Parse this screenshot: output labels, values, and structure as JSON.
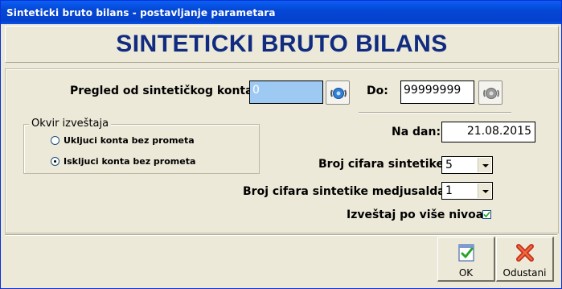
{
  "window": {
    "title": "Sinteticki bruto bilans - postavljanje parametara"
  },
  "heading": "SINTETICKI BRUTO BILANS",
  "range": {
    "from_label": "Pregled od sintetičkog konta:",
    "from_value": "0",
    "to_label": "Do:",
    "to_value": "99999999"
  },
  "frame": {
    "legend": "Okvir izveštaja",
    "options": [
      {
        "label": "Ukljuci konta bez prometa",
        "selected": false
      },
      {
        "label": "Iskljuci konta bez prometa",
        "selected": true
      }
    ]
  },
  "date": {
    "label": "Na dan:",
    "value": "21.08.2015"
  },
  "digits": {
    "label": "Broj cifara sintetike:",
    "value": "5"
  },
  "digits_mid": {
    "label": "Broj cifara sintetike medjusalda:",
    "value": "1"
  },
  "multilevel": {
    "label": "Izveštaj po više nivoa",
    "checked": true
  },
  "buttons": {
    "ok": "OK",
    "cancel": "Odustani"
  },
  "colors": {
    "title_bar": "#0547d6",
    "heading": "#102b80",
    "field_highlight": "#9ec9f3"
  },
  "icons": {
    "lookup": "refresh-lookup-icon",
    "ok": "ok-check-icon",
    "cancel": "cancel-x-icon"
  }
}
